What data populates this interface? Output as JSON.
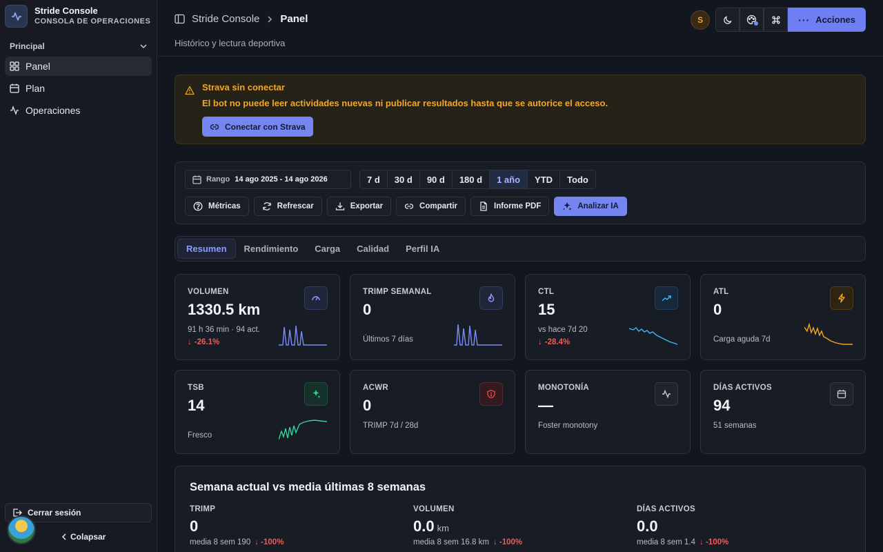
{
  "app": {
    "name": "Stride Console",
    "subtitle": "CONSOLA DE OPERACIONES"
  },
  "sidebar": {
    "section": "Principal",
    "items": [
      {
        "label": "Panel",
        "icon": "grid-icon",
        "active": true
      },
      {
        "label": "Plan",
        "icon": "calendar-icon"
      },
      {
        "label": "Operaciones",
        "icon": "activity-icon"
      }
    ],
    "logout": "Cerrar sesión",
    "collapse": "Colapsar"
  },
  "header": {
    "breadcrumb_parent": "Stride Console",
    "breadcrumb_current": "Panel",
    "subtitle": "Histórico y lectura deportiva",
    "user_initial": "S",
    "actions_label": "Acciones"
  },
  "alert": {
    "title": "Strava sin conectar",
    "text": "El bot no puede leer actividades nuevas ni publicar resultados hasta que se autorice el acceso.",
    "button": "Conectar con Strava"
  },
  "controls": {
    "range_label": "Rango",
    "range_value": "14 ago 2025 - 14 ago 2026",
    "periods": [
      "7 d",
      "30 d",
      "90 d",
      "180 d",
      "1 año",
      "YTD",
      "Todo"
    ],
    "active_period": "1 año",
    "actions": [
      "Métricas",
      "Refrescar",
      "Exportar",
      "Compartir",
      "Informe PDF",
      "Analizar IA"
    ]
  },
  "tabs": [
    "Resumen",
    "Rendimiento",
    "Carga",
    "Calidad",
    "Perfil IA"
  ],
  "cards": [
    {
      "title": "VOLUMEN",
      "value": "1330.5 km",
      "sub": "91 h 36 min · 94 act.",
      "delta": "-26.1%",
      "icon": "gauge-icon",
      "color": "#7c8cf8"
    },
    {
      "title": "TRIMP SEMANAL",
      "value": "0",
      "sub": "Últimos 7 días",
      "icon": "flame-icon",
      "color": "#7c8cf8"
    },
    {
      "title": "CTL",
      "value": "15",
      "sub": "vs hace 7d 20",
      "delta": "-28.4%",
      "icon": "trending-up-icon",
      "color": "#38bdf8"
    },
    {
      "title": "ATL",
      "value": "0",
      "sub": "Carga aguda 7d",
      "icon": "bolt-icon",
      "color": "#f5a623"
    },
    {
      "title": "TSB",
      "value": "14",
      "sub": "Fresco",
      "icon": "sparkle-icon",
      "color": "#34d399"
    },
    {
      "title": "ACWR",
      "value": "0",
      "sub": "TRIMP 7d / 28d",
      "icon": "shield-icon",
      "color": "#ef4444"
    },
    {
      "title": "MONOTONÍA",
      "value": "—",
      "sub": "Foster monotony",
      "icon": "pulse-icon",
      "color": "#c7ccd6"
    },
    {
      "title": "DÍAS ACTIVOS",
      "value": "94",
      "sub": "51 semanas",
      "icon": "calendar-icon",
      "color": "#c7ccd6"
    }
  ],
  "week": {
    "title": "Semana actual vs media últimas 8 semanas",
    "items": [
      {
        "label": "TRIMP",
        "value": "0",
        "unit": "",
        "sub": "media 8 sem 190",
        "delta": "-100%"
      },
      {
        "label": "VOLUMEN",
        "value": "0.0",
        "unit": "km",
        "sub": "media 8 sem 16.8 km",
        "delta": "-100%"
      },
      {
        "label": "DÍAS ACTIVOS",
        "value": "0.0",
        "unit": "",
        "sub": "media 8 sem 1.4",
        "delta": "-100%"
      }
    ]
  }
}
